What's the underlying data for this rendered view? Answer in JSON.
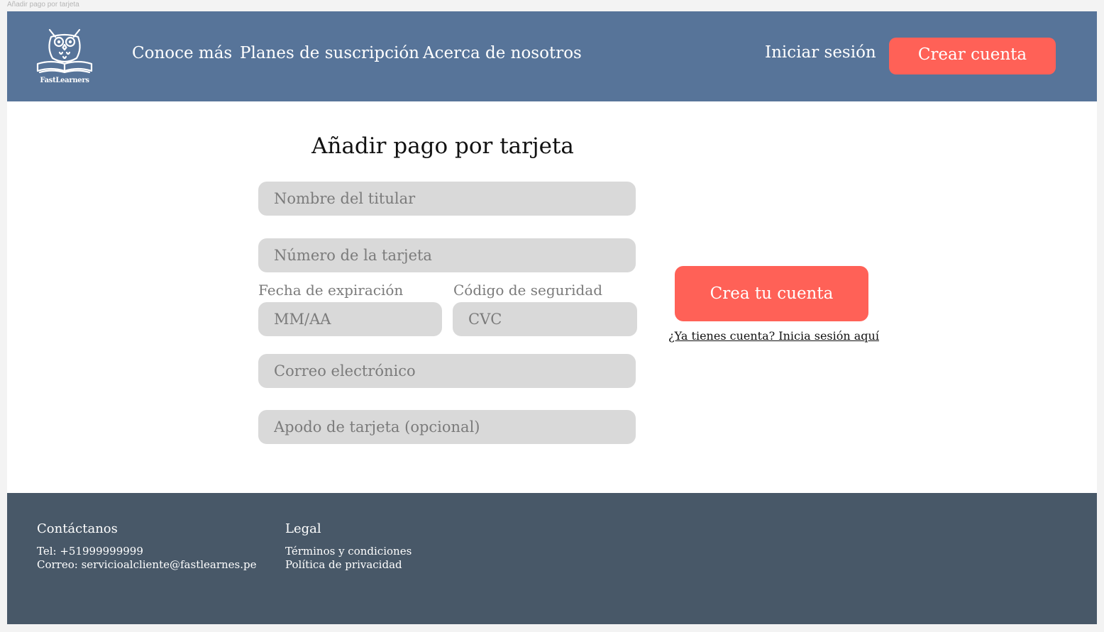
{
  "window": {
    "frame_label": "Añadir pago por tarjeta"
  },
  "header": {
    "logo_text": "FastLearners",
    "nav": [
      "Conoce más",
      "Planes de suscripción",
      "Acerca de nosotros"
    ],
    "login_label": "Iniciar sesión",
    "signup_label": "Crear cuenta"
  },
  "form": {
    "title": "Añadir pago por tarjeta",
    "holder_placeholder": "Nombre del titular",
    "card_number_placeholder": "Número de la tarjeta",
    "expiry_label": "Fecha de expiración",
    "expiry_placeholder": "MM/AA",
    "cvc_label": "Código de seguridad",
    "cvc_placeholder": "CVC",
    "email_placeholder": "Correo electrónico",
    "nickname_placeholder": "Apodo de tarjeta (opcional)",
    "submit_label": "Crea tu cuenta",
    "signin_prompt": "¿Ya tienes cuenta? Inicia sesión aquí"
  },
  "footer": {
    "contact_heading": "Contáctanos",
    "contact_lines": [
      "Tel: +51999999999",
      "Correo: servicioalcliente@fastlearnes.pe"
    ],
    "legal_heading": "Legal",
    "legal_links": [
      "Términos y condiciones",
      "Política de privacidad"
    ]
  },
  "colors": {
    "header_bg": "#577499",
    "accent": "#ff6157",
    "footer_bg": "#485868",
    "field_bg": "#d9d9d9"
  },
  "icons": {
    "logo": "owl-on-book-icon"
  }
}
